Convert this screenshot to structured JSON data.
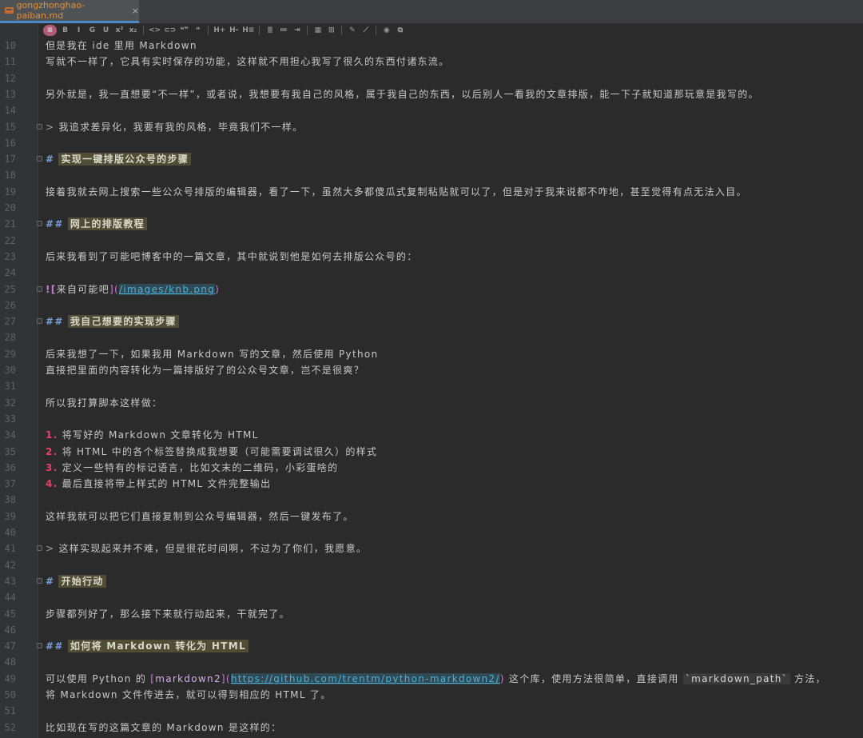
{
  "tab": {
    "filename": "gongzhonghao-paiban.md",
    "close_glyph": "×"
  },
  "toolbar": {
    "buttons": [
      "≡",
      "B",
      "I",
      "G",
      "U",
      "x²",
      "x₂",
      "<>",
      "⊂⊃",
      "❝❞",
      "❝",
      "H+",
      "H-",
      "H≡",
      "≣",
      "≔",
      "⇥",
      "▦",
      "⊞",
      "✎",
      "⟋",
      "◉",
      "⧉"
    ]
  },
  "lines": [
    {
      "n": "10",
      "text": "但是我在 ide 里用 Markdown"
    },
    {
      "n": "11",
      "text": "写就不一样了，它具有实时保存的功能，这样就不用担心我写了很久的东西付诸东流。"
    },
    {
      "n": "12",
      "text": ""
    },
    {
      "n": "13",
      "text": "另外就是，我一直想要“不一样”，或者说，我想要有我自己的风格，属于我自己的东西，以后别人一看我的文章排版，能一下子就知道那玩意是我写的。"
    },
    {
      "n": "14",
      "text": ""
    },
    {
      "n": "15",
      "quote": ">",
      "text": " 我追求差异化，我要有我的风格，毕竟我们不一样。"
    },
    {
      "n": "16",
      "text": ""
    },
    {
      "n": "17",
      "hmark": "#",
      "htext": "实现一键排版公众号的步骤"
    },
    {
      "n": "18",
      "text": ""
    },
    {
      "n": "19",
      "text": "接着我就去网上搜索一些公众号排版的编辑器，看了一下，虽然大多都傻瓜式复制粘贴就可以了，但是对于我来说都不咋地，甚至觉得有点无法入目。"
    },
    {
      "n": "20",
      "text": ""
    },
    {
      "n": "21",
      "hmark": "##",
      "htext": "网上的排版教程"
    },
    {
      "n": "22",
      "text": ""
    },
    {
      "n": "23",
      "text": "后来我看到了可能吧博客中的一篇文章，其中就说到他是如何去排版公众号的："
    },
    {
      "n": "24",
      "text": ""
    },
    {
      "n": "25",
      "img": {
        "mark": "![",
        "alt": "来自可能吧",
        "mid": "](",
        "url": "/images/knb.png",
        "end": ")"
      }
    },
    {
      "n": "26",
      "text": ""
    },
    {
      "n": "27",
      "hmark": "##",
      "htext": "我自己想要的实现步骤"
    },
    {
      "n": "28",
      "text": ""
    },
    {
      "n": "29",
      "text": "后来我想了一下，如果我用 Markdown 写的文章，然后使用 Python"
    },
    {
      "n": "30",
      "text": "直接把里面的内容转化为一篇排版好了的公众号文章，岂不是很爽？"
    },
    {
      "n": "31",
      "text": ""
    },
    {
      "n": "32",
      "text": "所以我打算脚本这样做："
    },
    {
      "n": "33",
      "text": ""
    },
    {
      "n": "34",
      "num": "1.",
      "text": " 将写好的 Markdown 文章转化为 HTML"
    },
    {
      "n": "35",
      "num": "2.",
      "text": " 将 HTML 中的各个标签替换成我想要（可能需要调试很久）的样式"
    },
    {
      "n": "36",
      "num": "3.",
      "text": " 定义一些特有的标记语言，比如文末的二维码，小彩蛋啥的"
    },
    {
      "n": "37",
      "num": "4.",
      "text": " 最后直接将带上样式的 HTML 文件完整输出"
    },
    {
      "n": "38",
      "text": ""
    },
    {
      "n": "39",
      "text": "这样我就可以把它们直接复制到公众号编辑器，然后一键发布了。"
    },
    {
      "n": "40",
      "text": ""
    },
    {
      "n": "41",
      "quote": ">",
      "text": " 这样实现起来并不难，但是很花时间啊，不过为了你们，我愿意。"
    },
    {
      "n": "42",
      "text": ""
    },
    {
      "n": "43",
      "hmark": "#",
      "htext": "开始行动"
    },
    {
      "n": "44",
      "text": ""
    },
    {
      "n": "45",
      "text": "步骤都列好了，那么接下来就行动起来，干就完了。"
    },
    {
      "n": "46",
      "text": ""
    },
    {
      "n": "47",
      "hmark": "##",
      "htext": "如何将 Markdown 转化为 HTML"
    },
    {
      "n": "48",
      "text": ""
    },
    {
      "n": "49",
      "link": {
        "pre": "可以使用 Python 的 ",
        "open": "[",
        "label": "markdown2",
        "mid": "](",
        "url": "https://github.com/trentm/python-markdown2/",
        "close": ")",
        "post": " 这个库，使用方法很简单，直接调用 ",
        "code": "`markdown_path`",
        "tail": " 方法，"
      }
    },
    {
      "n": "50",
      "text": "将 Markdown 文件传进去，就可以得到相应的 HTML 了。"
    },
    {
      "n": "51",
      "text": ""
    },
    {
      "n": "52",
      "text": "比如现在写的这篇文章的 Markdown 是这样的："
    }
  ]
}
